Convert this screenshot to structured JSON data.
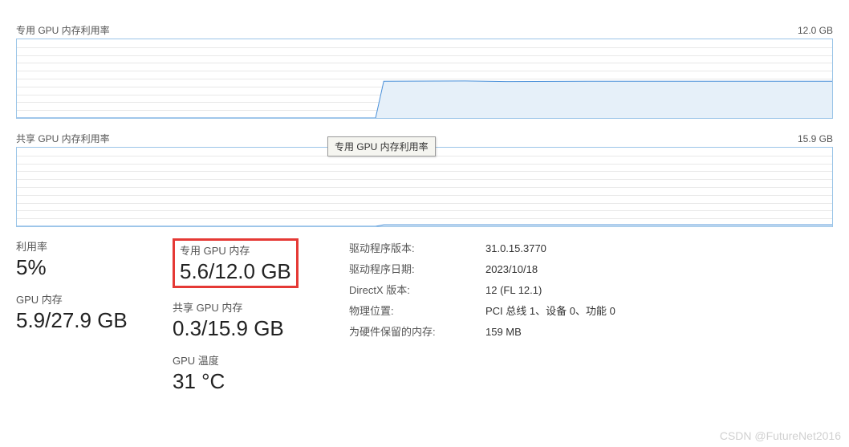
{
  "charts": {
    "dedicated": {
      "title": "专用 GPU 内存利用率",
      "max_label": "12.0 GB",
      "tooltip": "专用 GPU 内存利用率"
    },
    "shared": {
      "title": "共享 GPU 内存利用率",
      "max_label": "15.9 GB"
    }
  },
  "chart_data": [
    {
      "type": "line",
      "title": "专用 GPU 内存利用率",
      "ylabel": "GB",
      "ylim": [
        0,
        12.0
      ],
      "x": [
        0,
        0.44,
        0.45,
        0.55,
        0.6,
        0.7,
        0.8,
        0.9,
        1.0
      ],
      "values": [
        0,
        0,
        5.6,
        5.65,
        5.55,
        5.6,
        5.6,
        5.6,
        5.6
      ]
    },
    {
      "type": "line",
      "title": "共享 GPU 内存利用率",
      "ylabel": "GB",
      "ylim": [
        0,
        15.9
      ],
      "x": [
        0,
        0.44,
        0.45,
        1.0
      ],
      "values": [
        0,
        0,
        0.3,
        0.3
      ]
    }
  ],
  "stats": {
    "utilization": {
      "label": "利用率",
      "value": "5%"
    },
    "dedicated_mem": {
      "label": "专用 GPU 内存",
      "value": "5.6/12.0 GB"
    },
    "gpu_mem": {
      "label": "GPU 内存",
      "value": "5.9/27.9 GB"
    },
    "shared_mem": {
      "label": "共享 GPU 内存",
      "value": "0.3/15.9 GB"
    },
    "gpu_temp": {
      "label": "GPU 温度",
      "value": "31 °C"
    }
  },
  "details": {
    "driver_version": {
      "label": "驱动程序版本:",
      "value": "31.0.15.3770"
    },
    "driver_date": {
      "label": "驱动程序日期:",
      "value": "2023/10/18"
    },
    "directx": {
      "label": "DirectX 版本:",
      "value": "12 (FL 12.1)"
    },
    "location": {
      "label": "物理位置:",
      "value": "PCI 总线 1、设备 0、功能 0"
    },
    "reserved": {
      "label": "为硬件保留的内存:",
      "value": "159 MB"
    }
  },
  "watermark": "CSDN @FutureNet2016"
}
